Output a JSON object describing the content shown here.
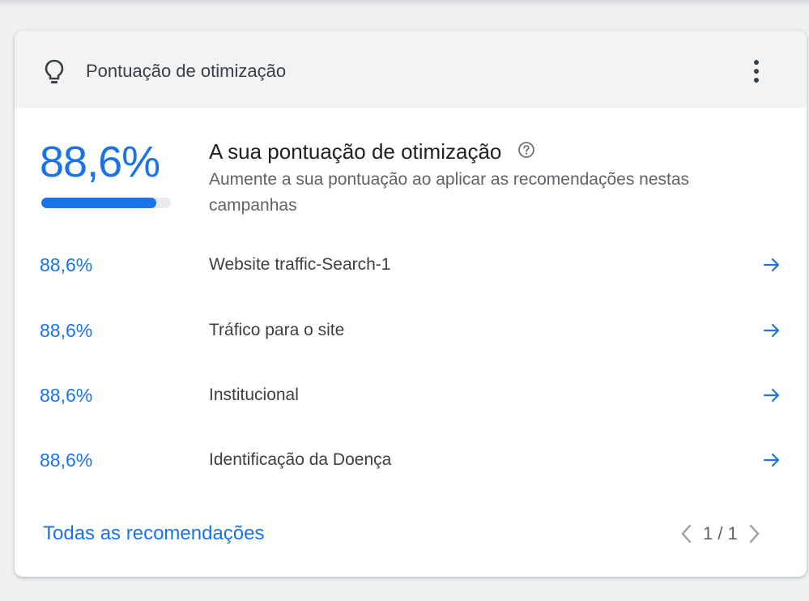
{
  "header": {
    "title": "Pontuação de otimização",
    "icon": "lightbulb-icon",
    "menu_icon": "more-vert-icon"
  },
  "summary": {
    "score_text": "88,6%",
    "score_fraction": 0.886,
    "title": "A sua pontuação de otimização",
    "description": "Aumente a sua pontuação ao aplicar as recomendações nestas campanhas"
  },
  "campaigns": [
    {
      "score": "88,6%",
      "name": "Website traffic-Search-1"
    },
    {
      "score": "88,6%",
      "name": "Tráfico para o site"
    },
    {
      "score": "88,6%",
      "name": "Institucional"
    },
    {
      "score": "88,6%",
      "name": "Identificação da Doença"
    }
  ],
  "footer": {
    "link_label": "Todas as recomendações",
    "pagination": "1 / 1"
  },
  "colors": {
    "accent": "#1a73e8",
    "header_bg": "#f1f3f4",
    "text_primary": "#202124",
    "text_secondary": "#5f6368"
  }
}
